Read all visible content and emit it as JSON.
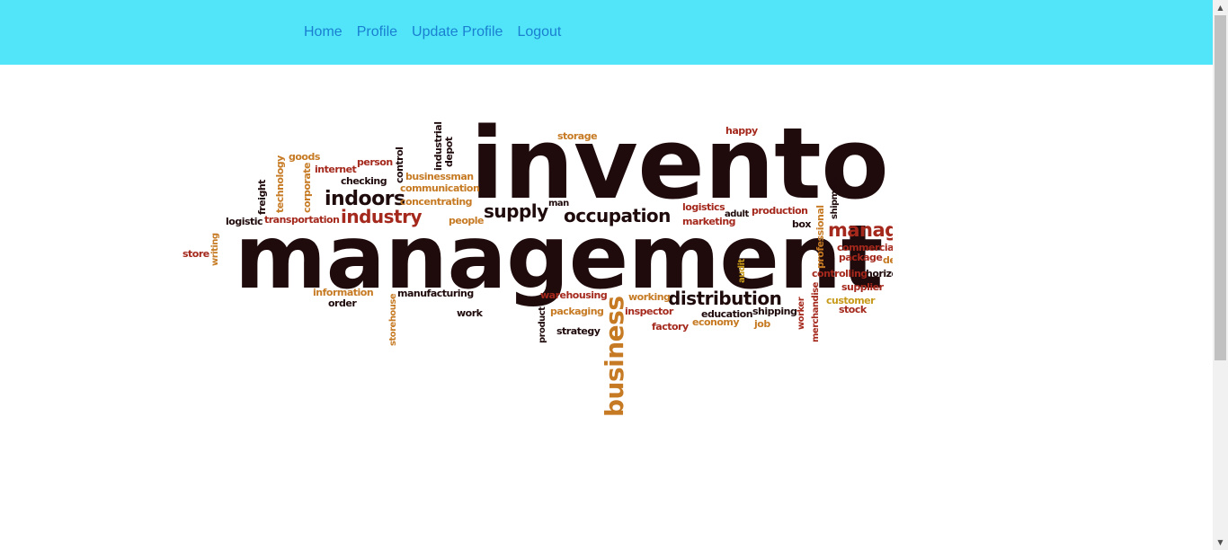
{
  "nav": {
    "links": [
      "Home",
      "Profile",
      "Update Profile",
      "Logout"
    ]
  },
  "colors": {
    "navbar_bg": "#52e5f9",
    "link": "#1a7fd1",
    "cloud_dark": "#1f0a0c",
    "cloud_red": "#a4281c",
    "cloud_orange": "#c67a23",
    "cloud_gold": "#c79a1a"
  },
  "wordcloud": {
    "big_words": [
      "inventory",
      "management"
    ],
    "words": [
      "storage",
      "happy",
      "goods",
      "person",
      "control",
      "industrial",
      "depot",
      "internet",
      "businessman",
      "freight",
      "technology",
      "corporate",
      "checking",
      "communication",
      "indoors",
      "concentrating",
      "man",
      "supply",
      "logistics",
      "shipment",
      "adult",
      "production",
      "occupation",
      "industry",
      "logistic",
      "transportation",
      "people",
      "marketing",
      "box",
      "manager",
      "career",
      "professional",
      "commercial",
      "store",
      "writing",
      "package",
      "delivery",
      "audit",
      "controlling",
      "horizontal",
      "supplier",
      "information",
      "manufacturing",
      "warehousing",
      "working",
      "distribution",
      "order",
      "storehouse",
      "customer",
      "packaging",
      "inspector",
      "education",
      "shipping",
      "worker",
      "stock",
      "merchandise",
      "work",
      "product",
      "economy",
      "factory",
      "job",
      "strategy",
      "business"
    ]
  }
}
